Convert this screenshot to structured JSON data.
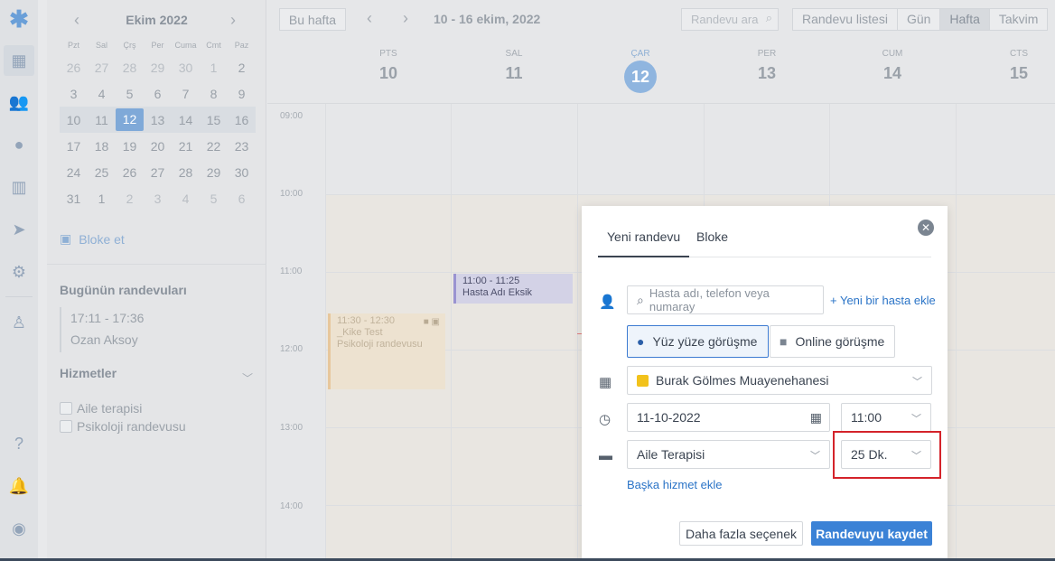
{
  "rail": {
    "icons": [
      "logo-icon",
      "calendar-icon",
      "users-icon",
      "chat-icon",
      "stats-icon",
      "send-icon",
      "gear-icon",
      "profile-icon",
      "help-icon",
      "bell-icon",
      "account-icon"
    ]
  },
  "mini_calendar": {
    "title": "Ekim 2022",
    "weekdays": [
      "Pzt",
      "Sal",
      "Çrş",
      "Per",
      "Cuma",
      "Cmt",
      "Paz"
    ],
    "weeks": [
      [
        "26",
        "27",
        "28",
        "29",
        "30",
        "1",
        "2"
      ],
      [
        "3",
        "4",
        "5",
        "6",
        "7",
        "8",
        "9"
      ],
      [
        "10",
        "11",
        "12",
        "13",
        "14",
        "15",
        "16"
      ],
      [
        "17",
        "18",
        "19",
        "20",
        "21",
        "22",
        "23"
      ],
      [
        "24",
        "25",
        "26",
        "27",
        "28",
        "29",
        "30"
      ],
      [
        "31",
        "1",
        "2",
        "3",
        "4",
        "5",
        "6"
      ]
    ],
    "selected": "12"
  },
  "side": {
    "block_label": "Bloke et",
    "today_title": "Bugünün randevuları",
    "today_time": "17:11 - 17:36",
    "today_name": "Ozan Aksoy",
    "services_title": "Hizmetler",
    "services": [
      "Aile terapisi",
      "Psikoloji randevusu"
    ]
  },
  "toolbar": {
    "this_week": "Bu hafta",
    "range": "10 - 16 ekim, 2022",
    "search_placeholder": "Randevu ara",
    "views": [
      "Randevu listesi",
      "Gün",
      "Hafta",
      "Takvim"
    ],
    "active_view": "Hafta"
  },
  "days": [
    {
      "name": "PTS",
      "num": "10"
    },
    {
      "name": "SAL",
      "num": "11"
    },
    {
      "name": "ÇAR",
      "num": "12"
    },
    {
      "name": "PER",
      "num": "13"
    },
    {
      "name": "CUM",
      "num": "14"
    },
    {
      "name": "CTS",
      "num": "15"
    }
  ],
  "hours": [
    "09:00",
    "10:00",
    "11:00",
    "12:00",
    "13:00",
    "14:00"
  ],
  "events": {
    "e1_time": "11:00 - 11:25",
    "e1_title": "Hasta Adı Eksik",
    "e2_time": "11:30 - 12:30",
    "e2_title": "_Kike Test",
    "e2_sub": "Psikoloji randevusu"
  },
  "modal": {
    "tab_new": "Yeni randevu",
    "tab_block": "Bloke",
    "patient_placeholder": "Hasta adı, telefon veya numaray",
    "add_patient": "+ Yeni bir hasta ekle",
    "mode_in_person": "Yüz yüze görüşme",
    "mode_online": "Online görüşme",
    "clinic": "Burak Gölmes Muayenehanesi",
    "date": "11-10-2022",
    "time": "11:00",
    "service": "Aile Terapisi",
    "duration": "25 Dk.",
    "add_service": "Başka hizmet ekle",
    "more_options": "Daha fazla seçenek",
    "save": "Randevuyu kaydet"
  }
}
